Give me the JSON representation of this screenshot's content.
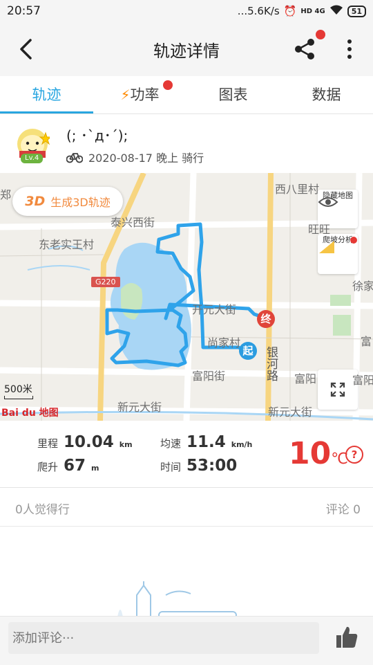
{
  "status_bar": {
    "time": "20:57",
    "network": "...5.6K/s",
    "signal": "HD 4G",
    "battery": "51"
  },
  "header": {
    "title": "轨迹详情"
  },
  "tabs": [
    {
      "label": "轨迹"
    },
    {
      "label": "功率"
    },
    {
      "label": "图表"
    },
    {
      "label": "数据"
    }
  ],
  "user": {
    "name": "(; ･`д･´);",
    "level": "Lv.4",
    "date": "2020-08-17 晚上 骑行"
  },
  "map": {
    "btn_3d_tag": "3D",
    "btn_3d_label": "生成3D轨迹",
    "hide_map_label": "隐藏地图",
    "climb_label": "爬坡分析",
    "scale": "500米",
    "provider": "Bai du 地图",
    "road_shield": "G220",
    "start_marker": "起",
    "end_marker": "终",
    "labels": [
      "郑",
      "西八里村",
      "泰兴西街",
      "旺旺",
      "东老实王村",
      "徐家",
      "开元大街",
      "尚家村",
      "富",
      "银河路",
      "富阳街",
      "富阳",
      "富阳",
      "新元大街",
      "新元大街"
    ]
  },
  "stats": {
    "distance": {
      "label": "里程",
      "value": "10.04",
      "unit": "km"
    },
    "speed": {
      "label": "均速",
      "value": "11.4",
      "unit": "km/h"
    },
    "climb": {
      "label": "爬升",
      "value": "67",
      "unit": "m"
    },
    "time": {
      "label": "时间",
      "value": "53:00"
    },
    "temperature": {
      "value": "10",
      "unit": "℃"
    },
    "help": "?"
  },
  "social": {
    "likes": "0人觉得行",
    "comments": "评论 0"
  },
  "comment": {
    "placeholder": "添加评论···"
  },
  "colors": {
    "accent": "#29a6e0",
    "route": "#2fa3ea",
    "temp": "#e53935",
    "orange": "#f18a3e"
  }
}
